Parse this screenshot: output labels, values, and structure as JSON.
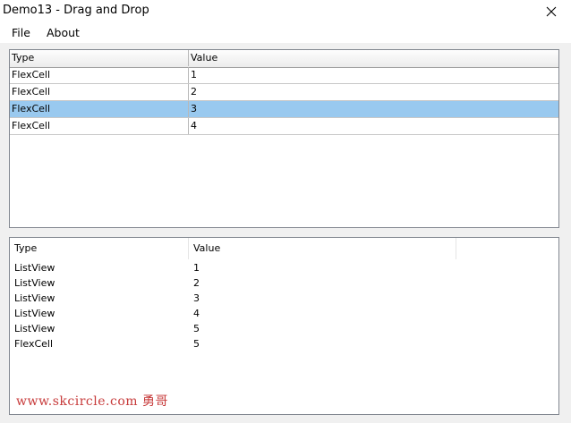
{
  "window": {
    "title": "Demo13 - Drag and Drop",
    "close_icon": "close-icon"
  },
  "menu": {
    "items": [
      "File",
      "About"
    ]
  },
  "grid": {
    "columns": [
      "Type",
      "Value"
    ],
    "rows": [
      {
        "type": "FlexCell",
        "value": "1",
        "selected": false
      },
      {
        "type": "FlexCell",
        "value": "2",
        "selected": false
      },
      {
        "type": "FlexCell",
        "value": "3",
        "selected": true
      },
      {
        "type": "FlexCell",
        "value": "4",
        "selected": false
      }
    ]
  },
  "listview": {
    "columns": [
      "Type",
      "Value"
    ],
    "rows": [
      {
        "type": "ListView",
        "value": "1"
      },
      {
        "type": "ListView",
        "value": "2"
      },
      {
        "type": "ListView",
        "value": "3"
      },
      {
        "type": "ListView",
        "value": "4"
      },
      {
        "type": "ListView",
        "value": "5"
      },
      {
        "type": "FlexCell",
        "value": "5"
      }
    ]
  },
  "watermark": "www.skcircle.com 勇哥",
  "colors": {
    "selection": "#99c9ef",
    "watermark": "#c73a3a"
  }
}
